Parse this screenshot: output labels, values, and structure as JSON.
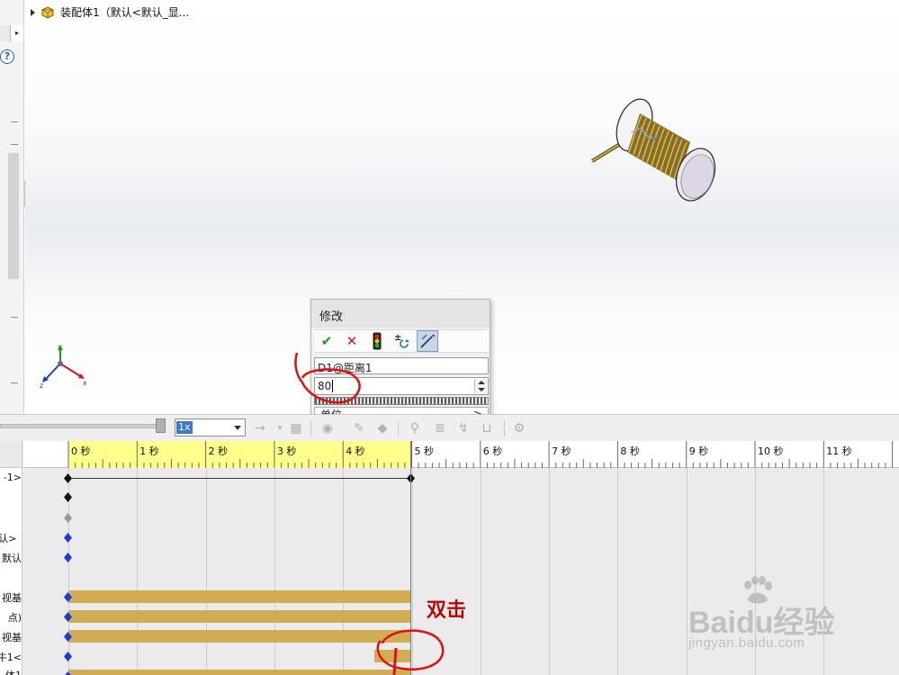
{
  "viewport": {
    "assembly_title": "装配体1（默认<默认_显..."
  },
  "modify_dialog": {
    "title": "修改",
    "dimension_name": "D1@距离1",
    "value": "80",
    "unit_label": "单位",
    "unit_arrow": ">"
  },
  "motion_toolbar": {
    "playback_speed": "1x"
  },
  "timeline": {
    "ruler_labels": [
      "0 秒",
      "1 秒",
      "2 秒",
      "3 秒",
      "4 秒",
      "5 秒",
      "6 秒",
      "7 秒",
      "8 秒",
      "9 秒",
      "10 秒",
      "11 秒"
    ],
    "tree_rows": [
      "-1>",
      "",
      "",
      "",
      "认>_",
      "默认",
      "",
      "视基",
      "点)",
      "视基",
      "牛1<",
      "体1"
    ]
  },
  "annotations": {
    "double_click_note": "双击"
  },
  "watermark": {
    "logo": "Baidu经验",
    "url": "jingyan.baidu.com"
  },
  "colors": {
    "accent_blue": "#3b78d0",
    "key_bar": "#d0ad55",
    "timeline_highlight": "#ffff8c",
    "annotation_red": "#c00000"
  }
}
